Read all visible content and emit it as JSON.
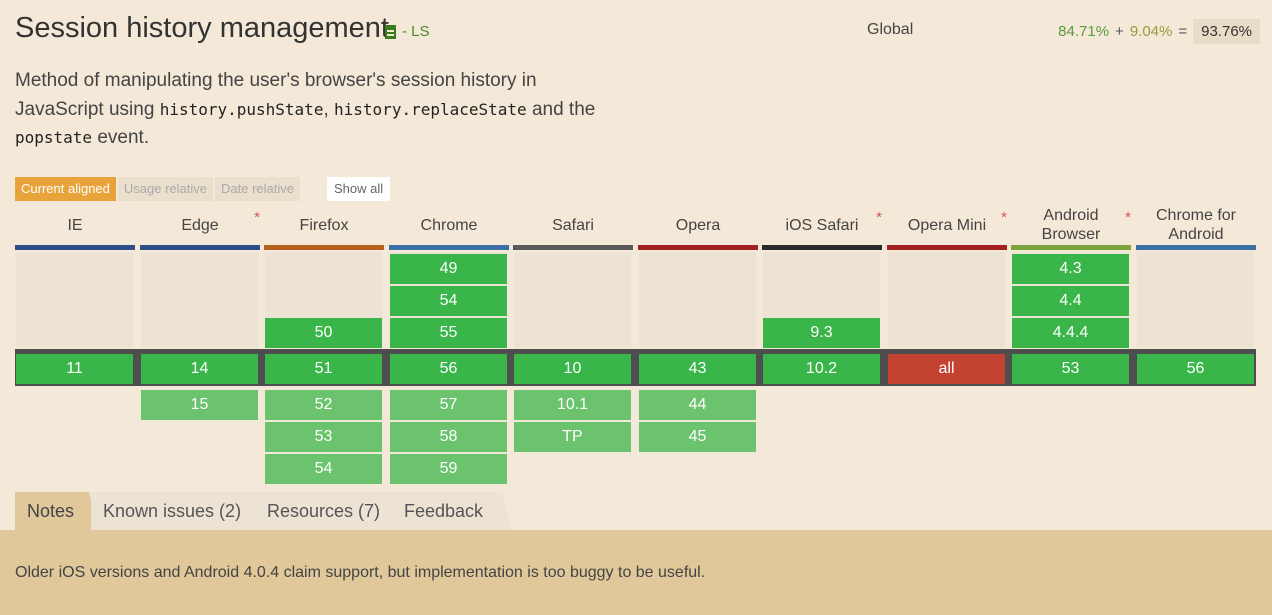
{
  "title": "Session history management",
  "spec_label": "- LS",
  "global_label": "Global",
  "usage": {
    "supported": "84.71%",
    "plus": "+",
    "partial": "9.04%",
    "equals": "=",
    "total": "93.76%"
  },
  "description": {
    "p1": "Method of manipulating the user's browser's session history in JavaScript using ",
    "code1": "history.pushState",
    "sep": ", ",
    "code2": "history.replaceState",
    "p2": " and the ",
    "code3": "popstate",
    "p3": " event."
  },
  "modes": {
    "current": "Current aligned",
    "usage": "Usage relative",
    "date": "Date relative",
    "show_all": "Show all"
  },
  "browsers": [
    {
      "name": "IE",
      "star": false,
      "color": "#2e4e8a",
      "past": [],
      "current": "11",
      "future": []
    },
    {
      "name": "Edge",
      "star": true,
      "color": "#2e4e8a",
      "past": [],
      "current": "14",
      "future": [
        "15"
      ]
    },
    {
      "name": "Firefox",
      "star": false,
      "color": "#b8611f",
      "past": [
        "50"
      ],
      "current": "51",
      "future": [
        "52",
        "53",
        "54"
      ]
    },
    {
      "name": "Chrome",
      "star": false,
      "color": "#3a6fa8",
      "past": [
        "49",
        "54",
        "55"
      ],
      "current": "56",
      "future": [
        "57",
        "58",
        "59"
      ]
    },
    {
      "name": "Safari",
      "star": false,
      "color": "#5a5a5a",
      "past": [],
      "current": "10",
      "future": [
        "10.1",
        "TP"
      ]
    },
    {
      "name": "Opera",
      "star": false,
      "color": "#a32121",
      "past": [],
      "current": "43",
      "future": [
        "44",
        "45"
      ]
    },
    {
      "name": "iOS Safari",
      "star": true,
      "color": "#2a2a2a",
      "past": [
        "9.3"
      ],
      "current": "10.2",
      "future": []
    },
    {
      "name": "Opera Mini",
      "star": true,
      "color": "#a32121",
      "past": [],
      "current": "all",
      "current_status": "n",
      "future": []
    },
    {
      "name": "Android Browser",
      "star": true,
      "color": "#7aa33a",
      "past": [
        "4.3",
        "4.4",
        "4.4.4"
      ],
      "current": "53",
      "future": []
    },
    {
      "name": "Chrome for Android",
      "star": false,
      "color": "#3a6fa8",
      "past": [],
      "current": "56",
      "future": []
    }
  ],
  "tabs": [
    "Notes",
    "Known issues (2)",
    "Resources (7)",
    "Feedback"
  ],
  "note": "Older iOS versions and Android 4.0.4 claim support, but implementation is too buggy to be useful."
}
